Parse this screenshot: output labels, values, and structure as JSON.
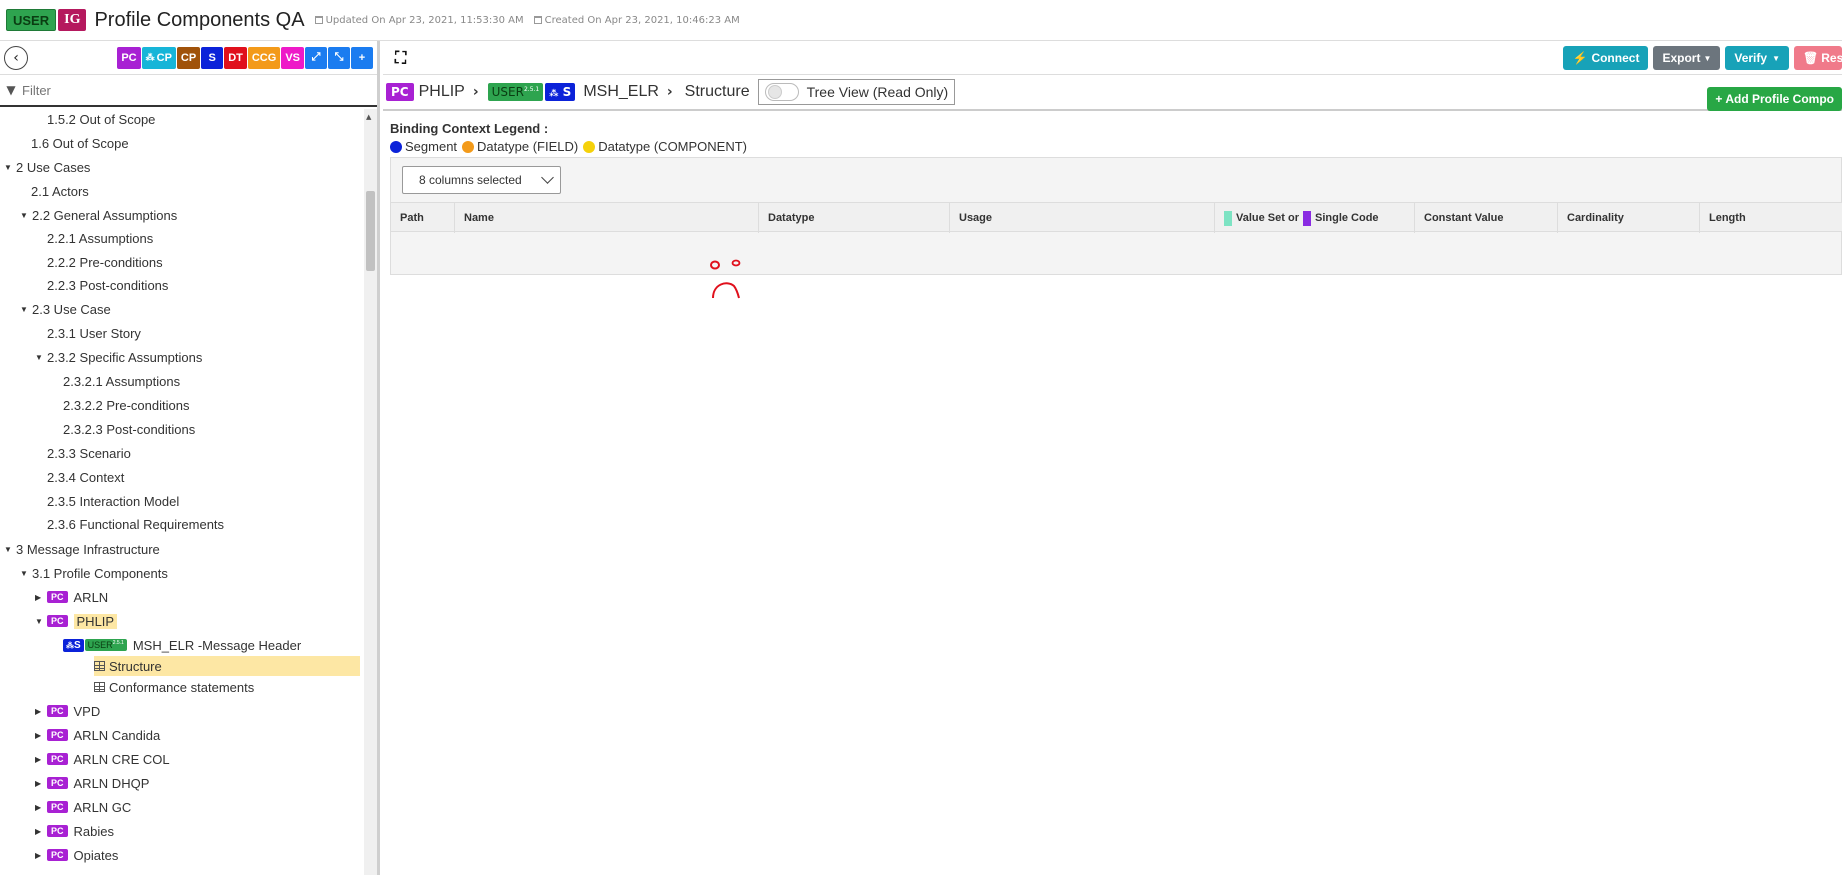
{
  "header": {
    "badge_user": "USER",
    "badge_ig": "IG",
    "title": "Profile Components QA",
    "updated": "Updated On Apr 23, 2021, 11:53:30 AM",
    "created": "Created On Apr 23, 2021, 10:46:23 AM"
  },
  "sidebar": {
    "type_buttons": [
      {
        "label": "PC",
        "color": "#a821d3"
      },
      {
        "label": "CP",
        "color": "#17b5d8"
      },
      {
        "label": "CP",
        "color": "#a0520a"
      },
      {
        "label": "S",
        "color": "#0b22d9"
      },
      {
        "label": "DT",
        "color": "#e0101c"
      },
      {
        "label": "CCG",
        "color": "#f39a1a"
      },
      {
        "label": "VS",
        "color": "#ee1ac8"
      }
    ],
    "filter_placeholder": "Filter",
    "tree": [
      {
        "label": "1.5.2 Out of Scope"
      },
      {
        "label": "1.6 Out of Scope"
      },
      {
        "label": "2 Use Cases"
      },
      {
        "label": "2.1 Actors"
      },
      {
        "label": "2.2 General Assumptions"
      },
      {
        "label": "2.2.1 Assumptions"
      },
      {
        "label": "2.2.2 Pre-conditions"
      },
      {
        "label": "2.2.3 Post-conditions"
      },
      {
        "label": "2.3 Use Case"
      },
      {
        "label": "2.3.1 User Story"
      },
      {
        "label": "2.3.2 Specific Assumptions"
      },
      {
        "label": "2.3.2.1 Assumptions"
      },
      {
        "label": "2.3.2.2 Pre-conditions"
      },
      {
        "label": "2.3.2.3 Post-conditions"
      },
      {
        "label": "2.3.3 Scenario"
      },
      {
        "label": "2.3.4 Context"
      },
      {
        "label": "2.3.5 Interaction Model"
      },
      {
        "label": "2.3.6 Functional Requirements"
      },
      {
        "label": "3 Message Infrastructure"
      },
      {
        "label": "3.1 Profile Components"
      },
      {
        "label": "ARLN"
      },
      {
        "label": "PHLIP"
      },
      {
        "label": "MSH_ELR -Message Header"
      },
      {
        "label": "Structure"
      },
      {
        "label": "Conformance statements"
      },
      {
        "label": "VPD"
      },
      {
        "label": "ARLN Candida"
      },
      {
        "label": "ARLN CRE COL"
      },
      {
        "label": "ARLN DHQP"
      },
      {
        "label": "ARLN GC"
      },
      {
        "label": "Rabies"
      },
      {
        "label": "Opiates"
      }
    ],
    "pc_badge": "PC",
    "s_badge": "S",
    "user_badge": "USER",
    "version": "2.5.1"
  },
  "toolbar": {
    "connect": "Connect",
    "export": "Export",
    "verify": "Verify",
    "reset": "Reset"
  },
  "crumb": {
    "pc_badge": "PC",
    "phlip": "PHLIP",
    "user_badge": "USER",
    "version": "2.5.1",
    "s_badge": "S",
    "segment": "MSH_ELR",
    "structure": "Structure",
    "tree_view": "Tree View (Read Only)"
  },
  "add_button": "Add Profile Compo",
  "legend": {
    "title": "Binding Context Legend :",
    "items": [
      {
        "label": "Segment",
        "color": "#0b22d9"
      },
      {
        "label": "Datatype (FIELD)",
        "color": "#f39a1a"
      },
      {
        "label": "Datatype (COMPONENT)",
        "color": "#f5d10a"
      }
    ]
  },
  "table": {
    "columns_selected": "8 columns selected",
    "headers": {
      "path": "Path",
      "name": "Name",
      "datatype": "Datatype",
      "usage": "Usage",
      "vs_a": "Value Set or",
      "vs_b": "Single Code",
      "constant": "Constant Value",
      "cardinality": "Cardinality",
      "length": "Length"
    },
    "vs_colors": [
      "#7de3c3",
      "#8a2be2"
    ]
  }
}
